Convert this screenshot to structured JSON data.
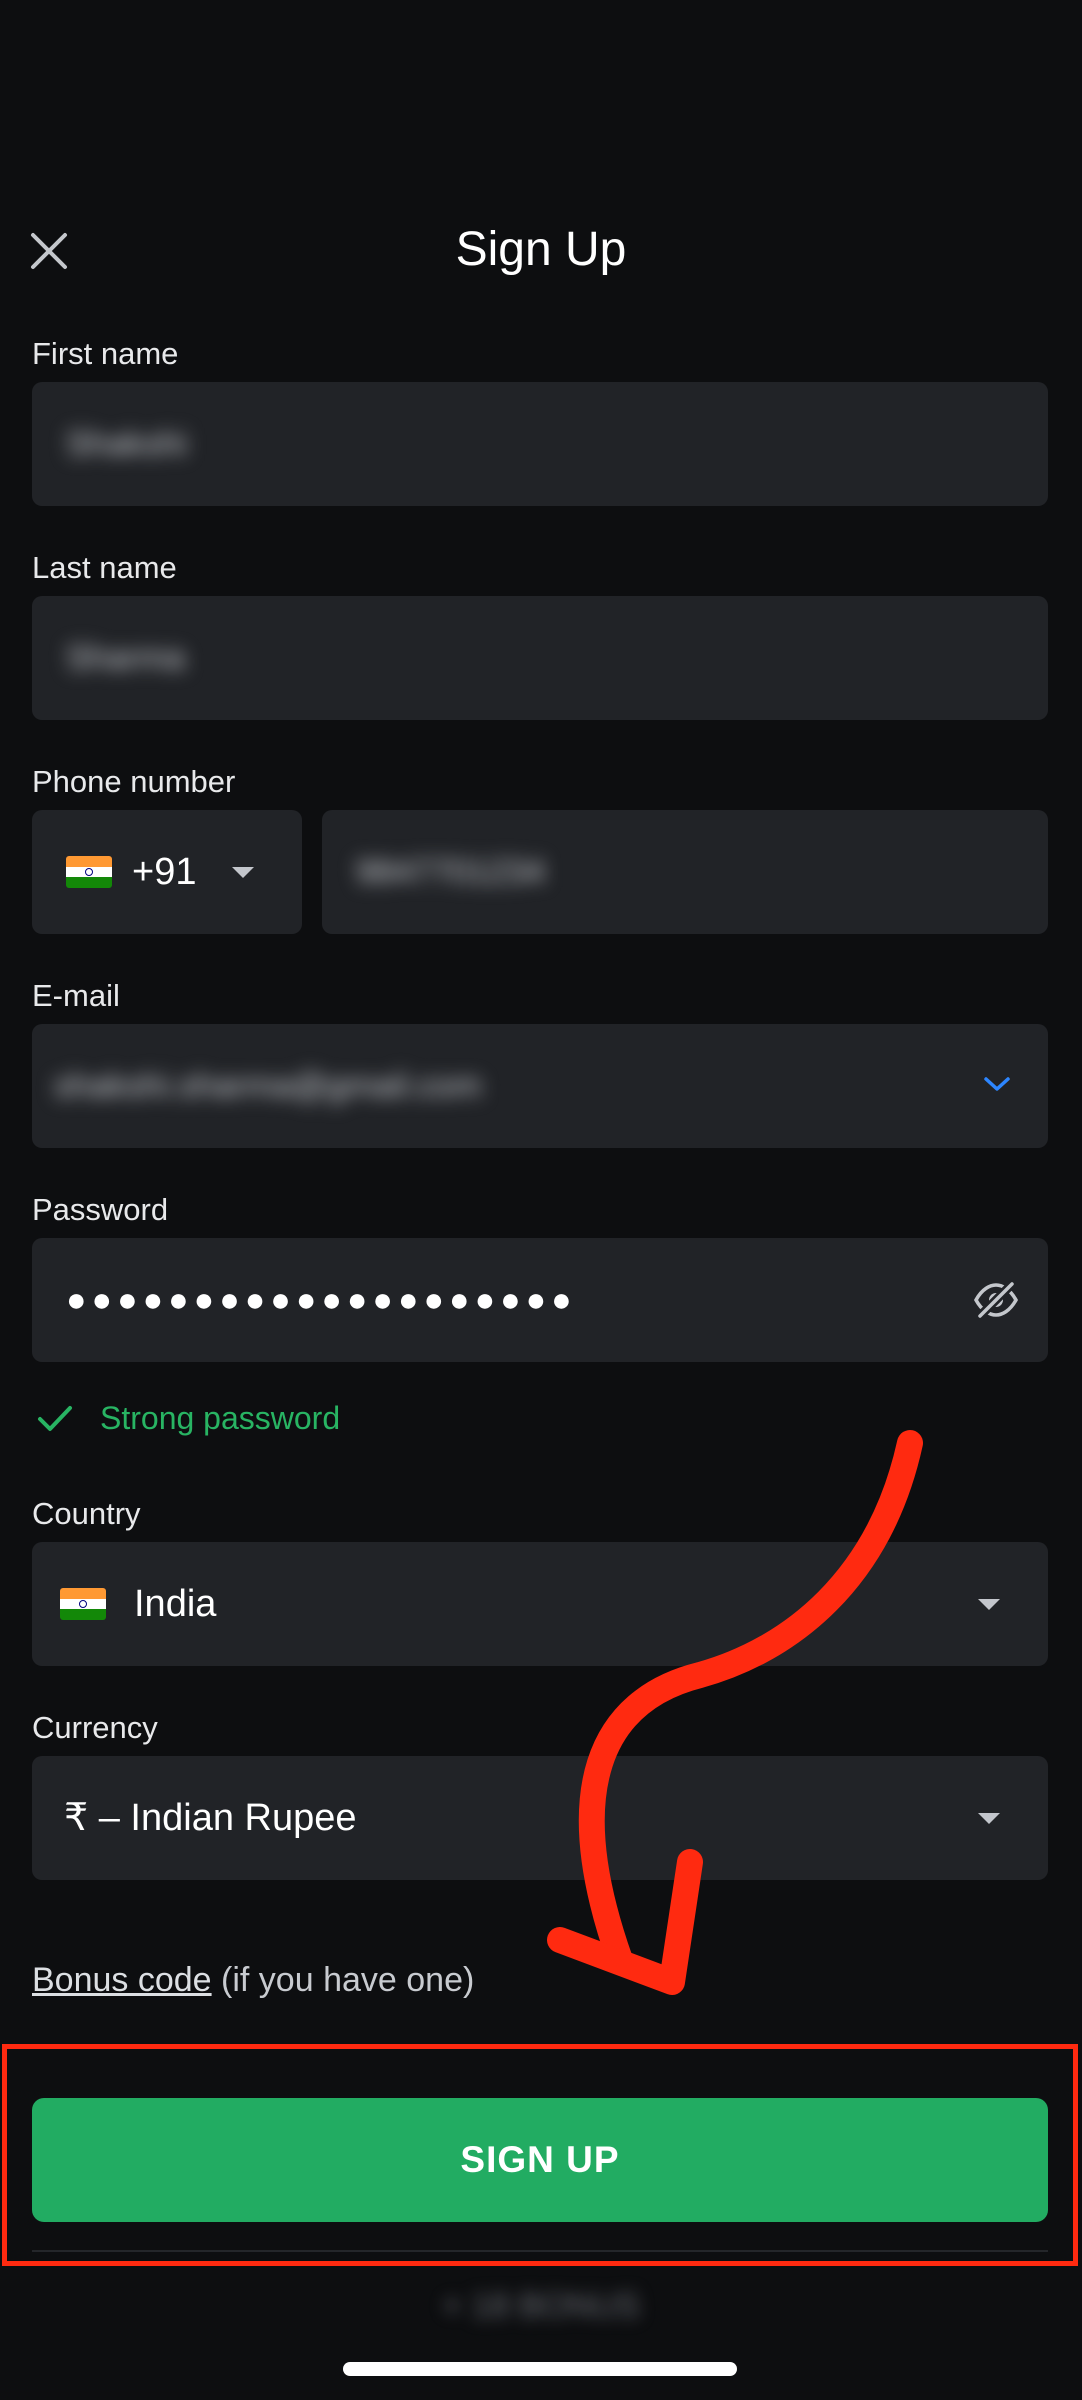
{
  "header": {
    "title": "Sign Up",
    "close_icon": "close-icon"
  },
  "form": {
    "first_name": {
      "label": "First name",
      "value": "Shakshi"
    },
    "last_name": {
      "label": "Last name",
      "value": "Sharma"
    },
    "phone": {
      "label": "Phone number",
      "code": "+91",
      "value": "9847701234"
    },
    "email": {
      "label": "E-mail",
      "value": "shakshi.sharma@gmail.com"
    },
    "password": {
      "label": "Password",
      "value": "●●●●●●●●●●●●●●●●●●●●",
      "strength": "Strong password"
    },
    "country": {
      "label": "Country",
      "value": "India"
    },
    "currency": {
      "label": "Currency",
      "value": "₹ – Indian Rupee"
    },
    "bonus": {
      "link": "Bonus code",
      "suffix": " (if you have one)"
    }
  },
  "actions": {
    "signup": "SIGN UP"
  },
  "footer": {
    "text": "+ 18 BONUS"
  },
  "colors": {
    "background": "#0d0e10",
    "field": "#212327",
    "accent_green": "#22ac62",
    "strong_green": "#28b463",
    "chevron_blue": "#2d86ff",
    "annotation_red": "#ff2a10"
  }
}
